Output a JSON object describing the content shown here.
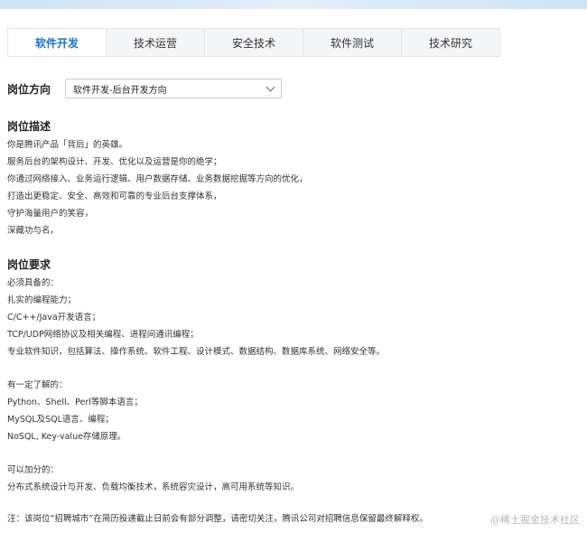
{
  "tabs": [
    {
      "label": "软件开发",
      "active": true
    },
    {
      "label": "技术运营",
      "active": false
    },
    {
      "label": "安全技术",
      "active": false
    },
    {
      "label": "软件测试",
      "active": false
    },
    {
      "label": "技术研究",
      "active": false
    }
  ],
  "position": {
    "label": "岗位方向",
    "selected": "软件开发-后台开发方向"
  },
  "description": {
    "title": "岗位描述",
    "lines": [
      "你是腾讯产品「背后」的英雄。",
      "服务后台的架构设计、开发、优化以及运营是你的绝学；",
      "你通过网络接入、业务运行逻辑、用户数据存储、业务数据挖掘等方向的优化，",
      "打造出更稳定、安全、高效和可靠的专业后台支撑体系，",
      "守护海量用户的笑容，",
      "深藏功与名。"
    ]
  },
  "requirements": {
    "title": "岗位要求",
    "groups": [
      {
        "lines": [
          "必须具备的：",
          "扎实的编程能力；",
          "C/C++/Java开发语言；",
          "TCP/UDP网络协议及相关编程、进程间通讯编程；",
          "专业软件知识，包括算法、操作系统、软件工程、设计模式、数据结构、数据库系统、网络安全等。"
        ]
      },
      {
        "lines": [
          "有一定了解的：",
          "Python、Shell、Perl等脚本语言；",
          "MySQL及SQL语言、编程；",
          "NoSQL, Key-value存储原理。"
        ]
      },
      {
        "lines": [
          "可以加分的：",
          "分布式系统设计与开发、负载均衡技术，系统容灾设计，高可用系统等知识。"
        ]
      }
    ]
  },
  "note": "注：该岗位“招聘城市”在简历投递截止日前会有部分调整，请密切关注，腾讯公司对招聘信息保留最终解释权。",
  "watermark": "@稀土掘金技术社区",
  "colors": {
    "accent": "#1a73c6",
    "tab_bg": "#f4f5f7"
  }
}
